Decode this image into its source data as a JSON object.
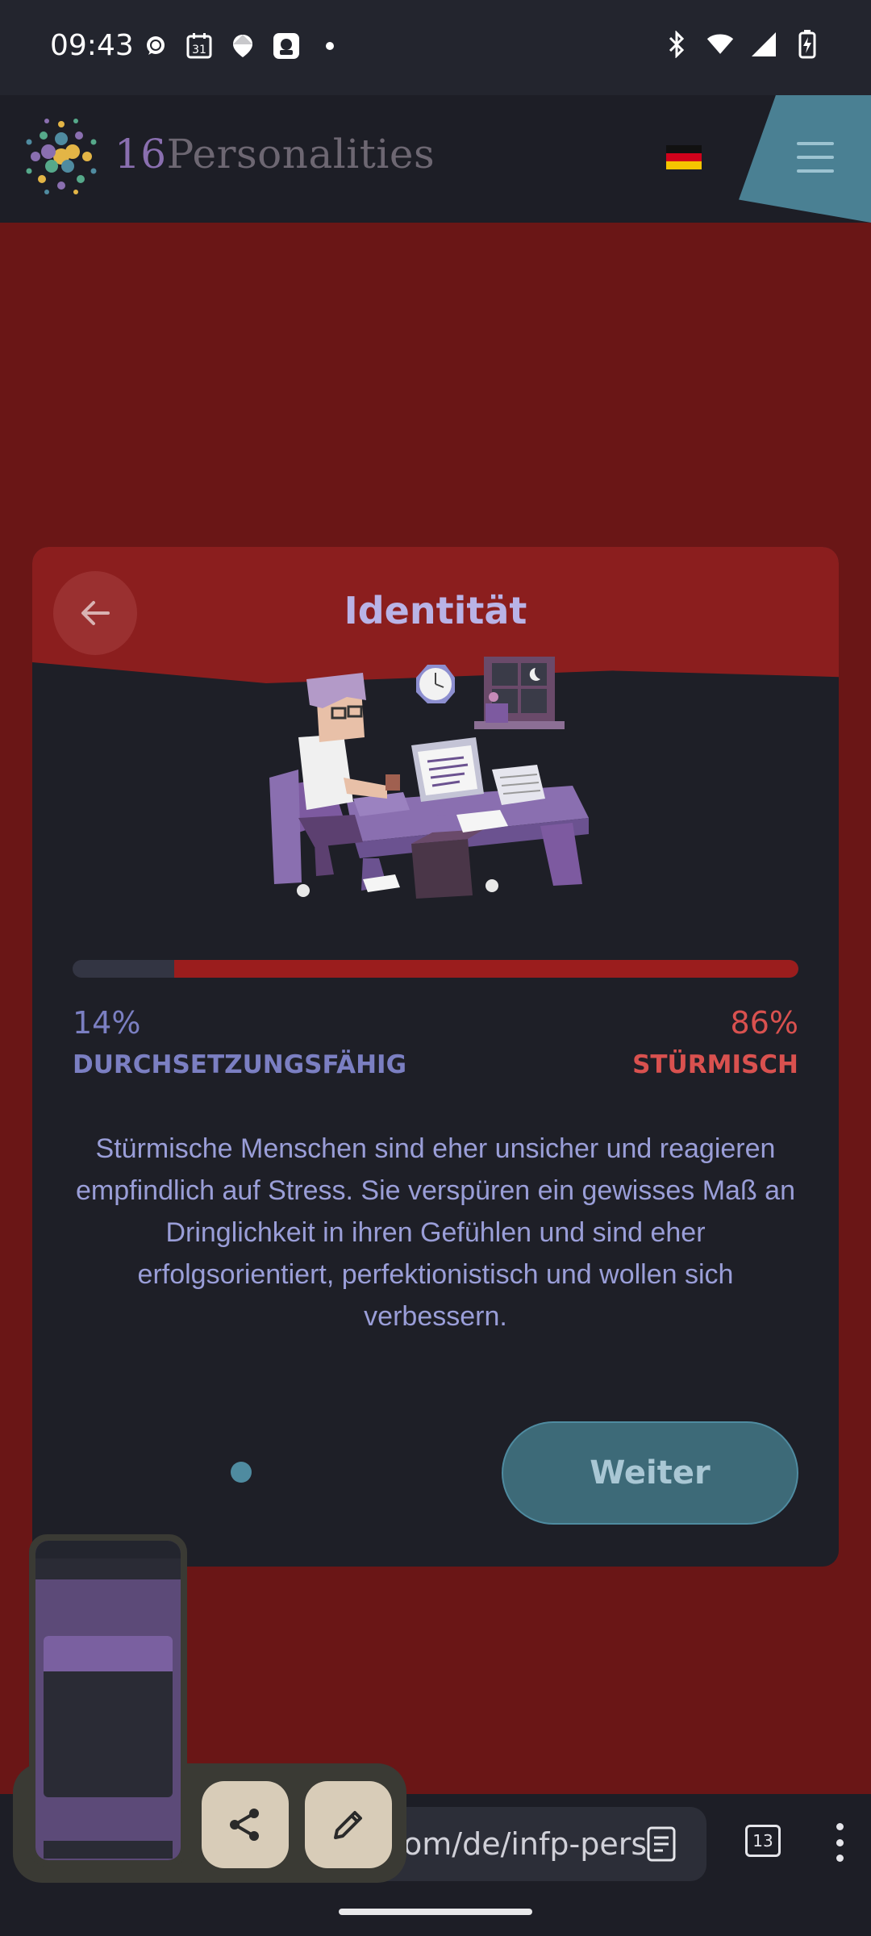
{
  "status_bar": {
    "time": "09:43",
    "left_icons": [
      "chat-bubble-icon",
      "calendar-31-icon",
      "maps-pin-icon",
      "app-square-icon",
      "dot-icon"
    ],
    "calendar_day": "31",
    "right_icons": [
      "bluetooth-icon",
      "wifi-icon",
      "signal-icon",
      "battery-charging-icon"
    ]
  },
  "header": {
    "logo_number": "16",
    "logo_word": "Personalities",
    "language_flag": "germany-flag-icon",
    "menu_icon": "hamburger-menu-icon"
  },
  "card": {
    "title": "Identität",
    "back_icon": "arrow-left-icon",
    "progress_fraction_right": 0.86,
    "left_percent": "14%",
    "left_label": "DURCHSETZUNGSFÄHIG",
    "right_percent": "86%",
    "right_label": "STÜRMISCH",
    "description": "Stürmische Menschen sind eher unsicher und reagieren empfindlich auf Stress. Sie verspüren ein gewisses Maß an Dringlichkeit in ihren Gefühlen und sind eher erfolgsorientiert, perfektionistisch und wollen sich verbessern.",
    "next_label": "Weiter",
    "colors": {
      "assertive": "#7b7fc2",
      "turbulent": "#d9514f",
      "header_red": "#8b1e1e",
      "button_teal": "#3d6a78"
    }
  },
  "browser": {
    "url": "om/de/infp-pers",
    "tab_count": "13",
    "reader_icon": "reader-mode-icon",
    "more_icon": "more-vert-icon"
  },
  "screenshot_overlay": {
    "share_icon": "share-icon",
    "edit_icon": "pencil-edit-icon"
  }
}
